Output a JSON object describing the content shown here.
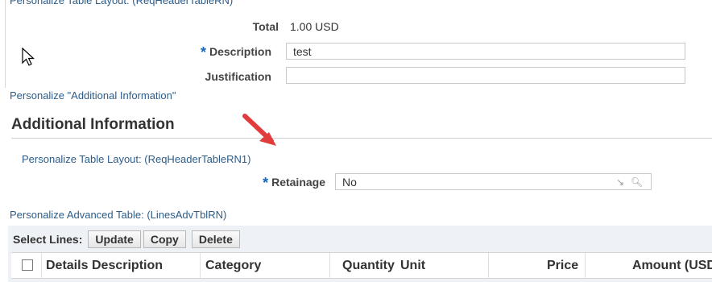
{
  "top_link": "Personalize Table Layout: (ReqHeaderTableRN)",
  "header": {
    "total_label": "Total",
    "total_value": "1.00 USD",
    "description_label": "Description",
    "description_value": "test",
    "justification_label": "Justification",
    "justification_value": ""
  },
  "links": {
    "personalize_additional_information": "Personalize \"Additional Information\"",
    "personalize_table_layout": "Personalize Table Layout: (ReqHeaderTableRN1)",
    "personalize_advanced_table": "Personalize Advanced Table: (LinesAdvTblRN)"
  },
  "section": {
    "title": "Additional Information",
    "retainage_label": "Retainage",
    "retainage_value": "No"
  },
  "toolbar": {
    "select_lines_label": "Select Lines:",
    "update_label": "Update",
    "copy_label": "Copy",
    "delete_label": "Delete"
  },
  "table": {
    "columns": [
      "Details",
      "Description",
      "Category",
      "Quantity",
      "Unit",
      "Price",
      "Amount (USD"
    ]
  },
  "icons": {
    "cursor": "mouse-pointer-icon",
    "arrow": "red-arrow-icon",
    "lov": "search-icon",
    "clear": "clear-icon"
  },
  "colors": {
    "link": "#2b5c8a",
    "required": "#1667b8",
    "arrow": "#e23b3b",
    "table_band": "#eef1f5"
  }
}
